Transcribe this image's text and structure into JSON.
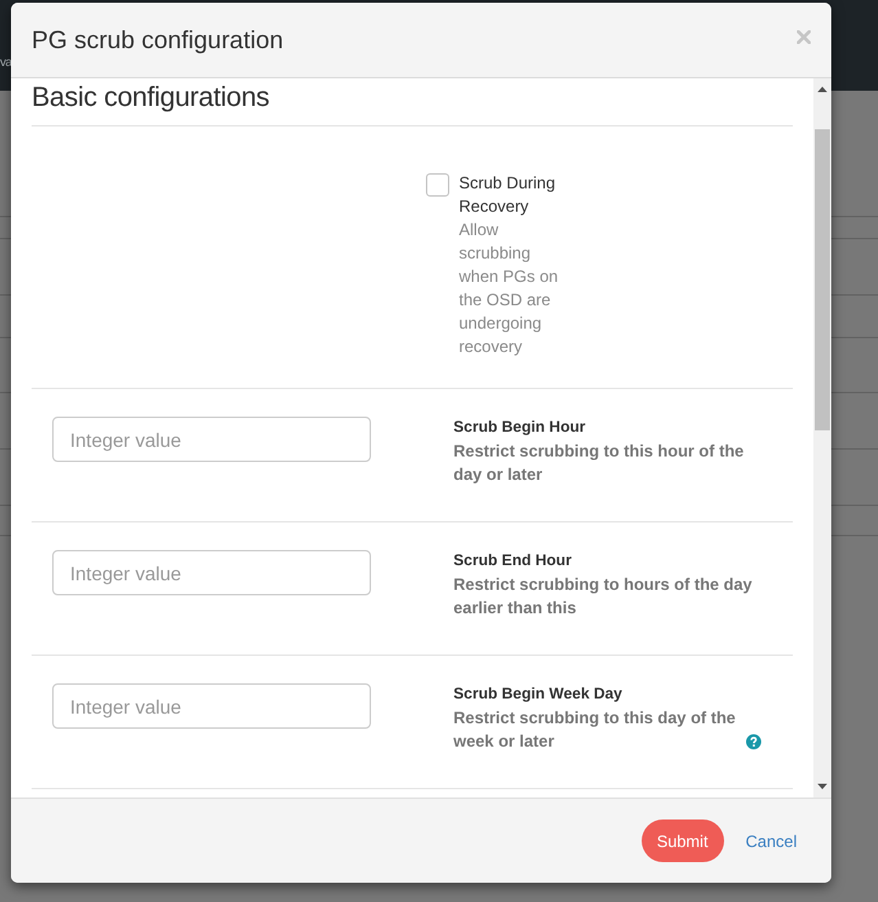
{
  "background": {
    "navbar_text": "va"
  },
  "window": {
    "title": "PG scrub configuration"
  },
  "section": {
    "title": "Basic configurations"
  },
  "fields": [
    {
      "kind": "checkbox",
      "label": "Scrub During Recovery",
      "description": "Allow scrubbing when PGs on the OSD are undergoing recovery",
      "checked": false
    },
    {
      "kind": "input",
      "label": "Scrub Begin Hour",
      "description": "Restrict scrubbing to this hour of the day or later",
      "placeholder": "Integer value"
    },
    {
      "kind": "input",
      "label": "Scrub End Hour",
      "description": "Restrict scrubbing to hours of the day earlier than this",
      "placeholder": "Integer value"
    },
    {
      "kind": "input",
      "label": "Scrub Begin Week Day",
      "description": "Restrict scrubbing to this day of the week or later",
      "placeholder": "Integer value",
      "help": true
    }
  ],
  "buttons": [
    {
      "kind": "primary",
      "label": "Submit"
    },
    {
      "kind": "link",
      "label": "Cancel"
    }
  ]
}
